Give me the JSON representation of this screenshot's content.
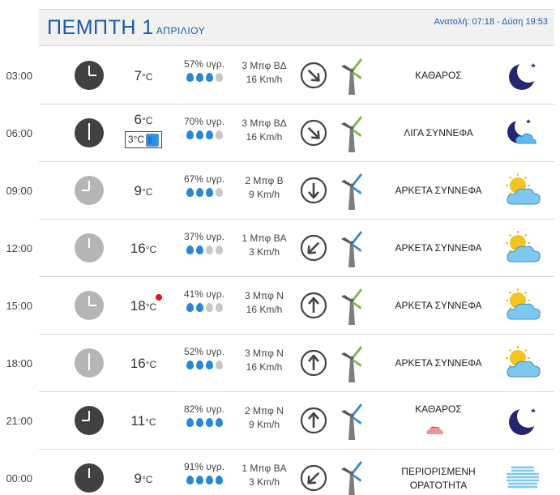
{
  "header": {
    "day": "ΠΕΜΠΤΗ 1",
    "month": "ΑΠΡΙΛΙΟΥ",
    "sun": "Ανατολή: 07:18 - Δύση 19:53"
  },
  "rows": [
    {
      "time": "03:00",
      "temp": "7",
      "humidity": "57% υγρ.",
      "wind1": "3 Μπφ ΒΔ",
      "wind2": "16 Km/h",
      "condition": "ΚΑΘΑΡΟΣ",
      "clock": "night",
      "arrow": "down-right",
      "turbine": "green",
      "icon": "moon-icon",
      "drops": 3
    },
    {
      "time": "06:00",
      "temp": "6",
      "feels": "3°C",
      "humidity": "70% υγρ.",
      "wind1": "3 Μπφ ΒΔ",
      "wind2": "16 Km/h",
      "condition": "ΛΙΓΑ ΣΥΝΝΕΦΑ",
      "clock": "night",
      "arrow": "down-right",
      "turbine": "green",
      "icon": "moon-cloud-icon",
      "drops": 3
    },
    {
      "time": "09:00",
      "temp": "9",
      "humidity": "67% υγρ.",
      "wind1": "2 Μπφ Β",
      "wind2": "9 Km/h",
      "condition": "ΑΡΚΕΤΑ ΣΥΝΝΕΦΑ",
      "clock": "day",
      "arrow": "down",
      "turbine": "blue",
      "icon": "sun-cloud-icon",
      "drops": 3
    },
    {
      "time": "12:00",
      "temp": "16",
      "humidity": "37% υγρ.",
      "wind1": "1 Μπφ ΒΑ",
      "wind2": "3 Km/h",
      "condition": "ΑΡΚΕΤΑ ΣΥΝΝΕΦΑ",
      "clock": "day",
      "arrow": "down-left",
      "turbine": "blue",
      "icon": "sun-cloud-icon",
      "drops": 2
    },
    {
      "time": "15:00",
      "temp": "18",
      "humidity": "41% υγρ.",
      "wind1": "3 Μπφ Ν",
      "wind2": "16 Km/h",
      "condition": "ΑΡΚΕΤΑ ΣΥΝΝΕΦΑ",
      "clock": "day",
      "arrow": "up",
      "turbine": "green",
      "icon": "sun-cloud-icon",
      "drops": 2,
      "hot": true
    },
    {
      "time": "18:00",
      "temp": "16",
      "humidity": "52% υγρ.",
      "wind1": "3 Μπφ Ν",
      "wind2": "16 Km/h",
      "condition": "ΑΡΚΕΤΑ ΣΥΝΝΕΦΑ",
      "clock": "day",
      "arrow": "up",
      "turbine": "green",
      "icon": "sun-cloud-icon",
      "drops": 3
    },
    {
      "time": "21:00",
      "temp": "11",
      "humidity": "82% υγρ.",
      "wind1": "2 Μπφ Ν",
      "wind2": "9 Km/h",
      "condition": "ΚΑΘΑΡΟΣ",
      "clock": "night",
      "arrow": "up",
      "turbine": "blue",
      "icon": "moon-icon",
      "drops": 4,
      "extra": true
    },
    {
      "time": "00:00",
      "temp": "9",
      "humidity": "91% υγρ.",
      "wind1": "1 Μπφ ΒΑ",
      "wind2": "3 Km/h",
      "condition": "ΠΕΡΙΟΡΙΣΜΕΝΗ ΟΡΑΤΟΤΗΤΑ",
      "clock": "night",
      "arrow": "down-left",
      "turbine": "blue",
      "icon": "fog-icon",
      "drops": 4
    }
  ],
  "units": {
    "deg": "°C"
  }
}
